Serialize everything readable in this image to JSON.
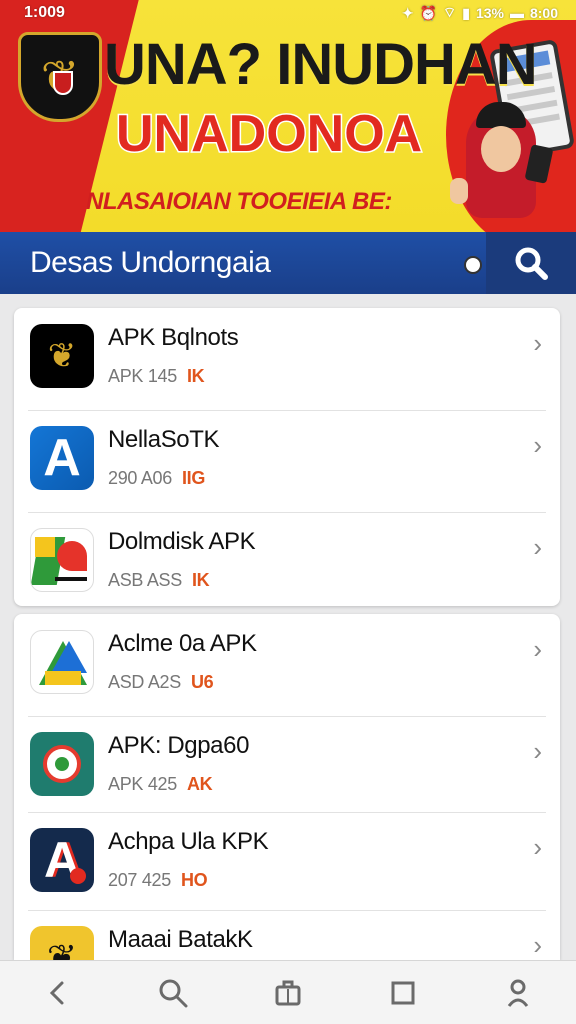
{
  "status_bar": {
    "time": "1:009",
    "battery": "13%",
    "clock_right": "8:00"
  },
  "banner": {
    "title": "UNA? INUDHAN",
    "subtitle": "UNADONOA",
    "tagline": "NLASAIOIAN TOOEIEIA BE:"
  },
  "header": {
    "title": "Desas Undorngaia"
  },
  "apps_group_1": [
    {
      "name": "APK Bqlnots",
      "size": "APK 145",
      "tag": "IK",
      "icon": "emblem-icon"
    },
    {
      "name": "NellaSoTK",
      "size": "290 A06",
      "tag": "IIG",
      "icon": "a-letter-icon"
    },
    {
      "name": "Dolmdisk APK",
      "size": "ASB ASS",
      "tag": "IK",
      "icon": "flag-icon"
    }
  ],
  "apps_group_2": [
    {
      "name": "Aclme 0a APK",
      "size": "ASD A2S",
      "tag": "U6",
      "icon": "triangle-icon"
    },
    {
      "name": "APK: Dgpa60",
      "size": "APK 425",
      "tag": "AK",
      "icon": "chat-bubble-icon"
    },
    {
      "name": "Achpa Ula KPK",
      "size": "207 425",
      "tag": "HO",
      "icon": "a-letter-dark-icon"
    },
    {
      "name": "Maaai BatakK",
      "size": "",
      "tag": "",
      "icon": "gold-emblem-icon"
    }
  ],
  "nav": [
    "back-icon",
    "search-icon",
    "briefcase-icon",
    "square-icon",
    "profile-icon"
  ]
}
